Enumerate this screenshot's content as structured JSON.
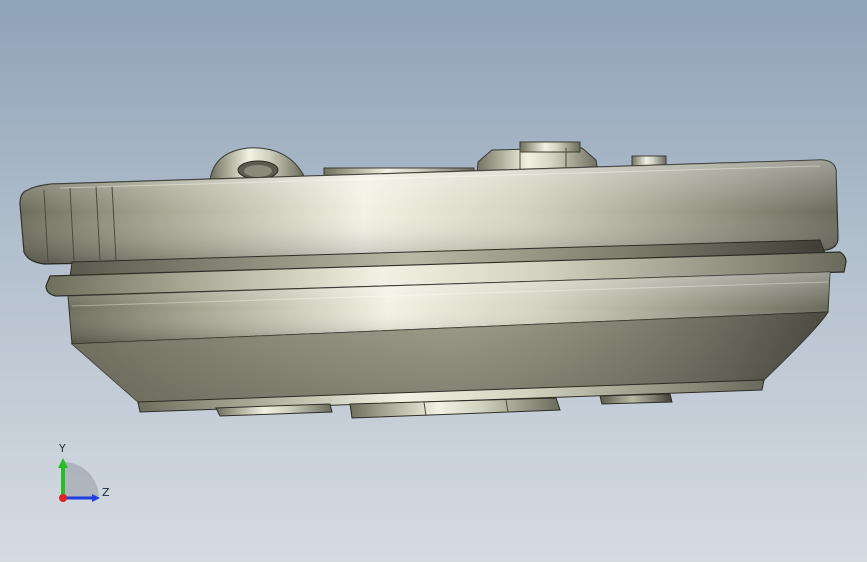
{
  "viewport": {
    "background_top": "#8ea2b8",
    "background_bottom": "#d6dbe2"
  },
  "triad": {
    "y_label": "Y",
    "z_label": "Z",
    "y_color": "#22c022",
    "z_color": "#1f3fe0",
    "x_color": "#e02020"
  }
}
